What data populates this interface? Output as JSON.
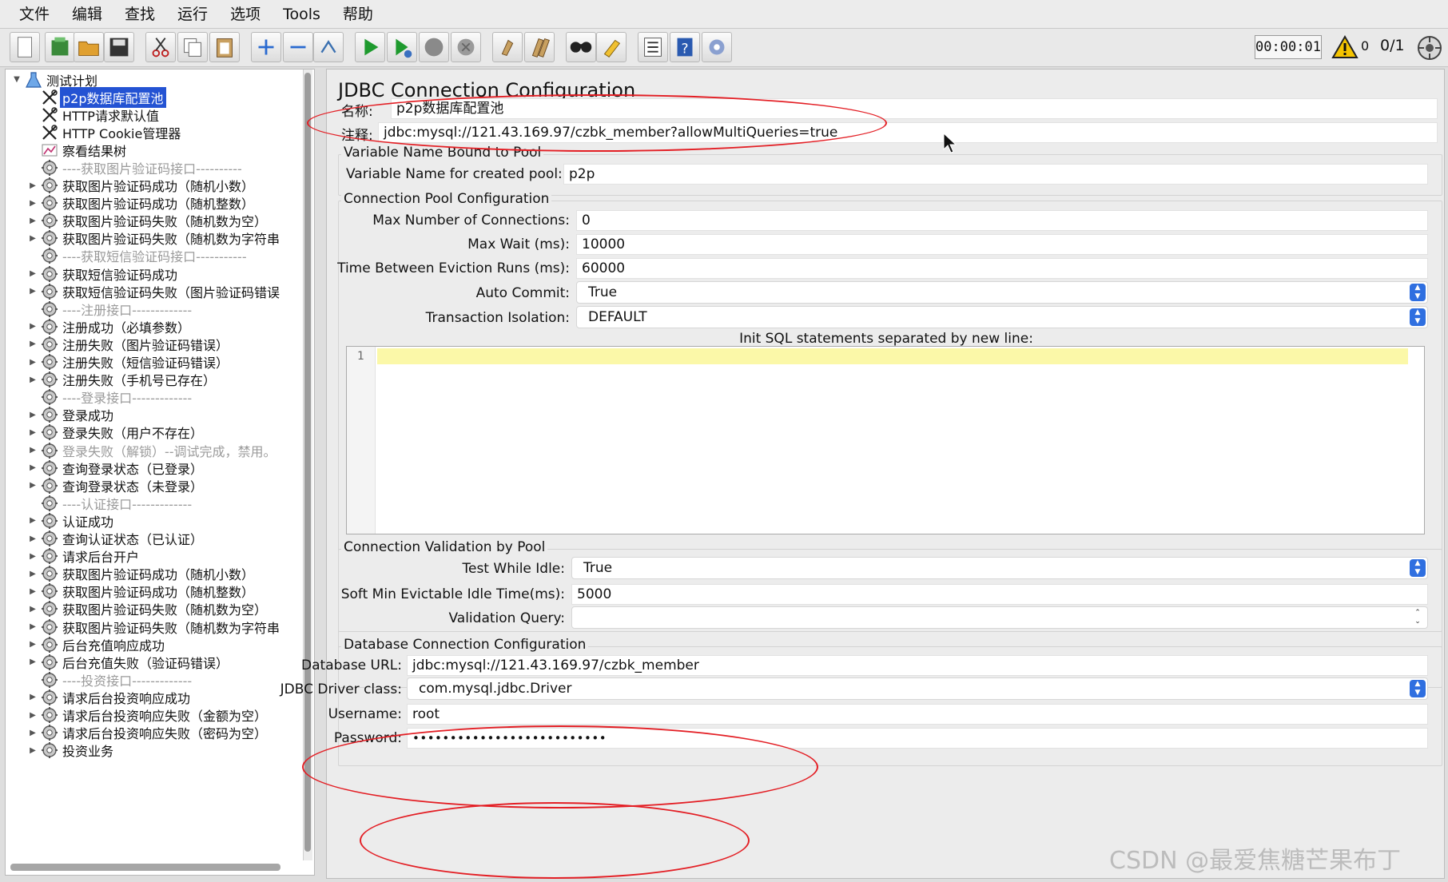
{
  "menu": [
    "文件",
    "编辑",
    "查找",
    "运行",
    "选项",
    "Tools",
    "帮助"
  ],
  "toolbar": {
    "timer": "00:00:01",
    "warning_count": "0",
    "threads": "0/1",
    "buttons": [
      "new",
      "templates",
      "open",
      "save",
      "cut",
      "copy",
      "paste",
      "expand",
      "collapse",
      "toggle",
      "start",
      "start-no-pause",
      "stop",
      "shutdown",
      "clear",
      "clear-all",
      "search",
      "reset-search",
      "function-helper",
      "help",
      "remote"
    ]
  },
  "tree": {
    "root": "测试计划",
    "items": [
      {
        "label": "p2p数据库配置池",
        "type": "config",
        "selected": true,
        "expandable": false
      },
      {
        "label": "HTTP请求默认值",
        "type": "config",
        "expandable": false
      },
      {
        "label": "HTTP Cookie管理器",
        "type": "config",
        "expandable": false
      },
      {
        "label": "察看结果树",
        "type": "listener",
        "expandable": false
      },
      {
        "label": "----获取图片验证码接口----------",
        "type": "controller",
        "disabled": true,
        "expandable": false
      },
      {
        "label": "获取图片验证码成功（随机小数）",
        "type": "controller",
        "expandable": true
      },
      {
        "label": "获取图片验证码成功（随机整数）",
        "type": "controller",
        "expandable": true
      },
      {
        "label": "获取图片验证码失败（随机数为空）",
        "type": "controller",
        "expandable": true
      },
      {
        "label": "获取图片验证码失败（随机数为字符串",
        "type": "controller",
        "expandable": true
      },
      {
        "label": "----获取短信验证码接口-----------",
        "type": "controller",
        "disabled": true,
        "expandable": false
      },
      {
        "label": "获取短信验证码成功",
        "type": "controller",
        "expandable": true
      },
      {
        "label": "获取短信验证码失败（图片验证码错误",
        "type": "controller",
        "expandable": true
      },
      {
        "label": "----注册接口-------------",
        "type": "controller",
        "disabled": true,
        "expandable": false
      },
      {
        "label": "注册成功（必填参数）",
        "type": "controller",
        "expandable": true
      },
      {
        "label": "注册失败（图片验证码错误）",
        "type": "controller",
        "expandable": true
      },
      {
        "label": "注册失败（短信验证码错误）",
        "type": "controller",
        "expandable": true
      },
      {
        "label": "注册失败（手机号已存在）",
        "type": "controller",
        "expandable": true
      },
      {
        "label": "----登录接口-------------",
        "type": "controller",
        "disabled": true,
        "expandable": false
      },
      {
        "label": "登录成功",
        "type": "controller",
        "expandable": true
      },
      {
        "label": "登录失败（用户不存在）",
        "type": "controller",
        "expandable": true
      },
      {
        "label": "登录失败（解锁）--调试完成，禁用。",
        "type": "controller",
        "disabled": true,
        "expandable": true
      },
      {
        "label": "查询登录状态（已登录）",
        "type": "controller",
        "expandable": true
      },
      {
        "label": "查询登录状态（未登录）",
        "type": "controller",
        "expandable": true
      },
      {
        "label": "----认证接口-------------",
        "type": "controller",
        "disabled": true,
        "expandable": false
      },
      {
        "label": "认证成功",
        "type": "controller",
        "expandable": true
      },
      {
        "label": "查询认证状态（已认证）",
        "type": "controller",
        "expandable": true
      },
      {
        "label": "请求后台开户",
        "type": "controller",
        "expandable": true
      },
      {
        "label": "获取图片验证码成功（随机小数）",
        "type": "controller",
        "expandable": true
      },
      {
        "label": "获取图片验证码成功（随机整数）",
        "type": "controller",
        "expandable": true
      },
      {
        "label": "获取图片验证码失败（随机数为空）",
        "type": "controller",
        "expandable": true
      },
      {
        "label": "获取图片验证码失败（随机数为字符串",
        "type": "controller",
        "expandable": true
      },
      {
        "label": "后台充值响应成功",
        "type": "controller",
        "expandable": true
      },
      {
        "label": "后台充值失败（验证码错误）",
        "type": "controller",
        "expandable": true
      },
      {
        "label": "----投资接口-------------",
        "type": "controller",
        "disabled": true,
        "expandable": false
      },
      {
        "label": "请求后台投资响应成功",
        "type": "controller",
        "expandable": true
      },
      {
        "label": "请求后台投资响应失败（金额为空）",
        "type": "controller",
        "expandable": true
      },
      {
        "label": "请求后台投资响应失败（密码为空）",
        "type": "controller",
        "expandable": true
      },
      {
        "label": "投资业务",
        "type": "controller",
        "expandable": true
      }
    ]
  },
  "panel": {
    "title": "JDBC Connection Configuration",
    "name_label": "名称:",
    "name_value": "p2p数据库配置池",
    "comment_label": "注释:",
    "comment_value": "jdbc:mysql://121.43.169.97/czbk_member?allowMultiQueries=true",
    "var_group": "Variable Name Bound to Pool",
    "var_label": "Variable Name for created pool:",
    "var_value": "p2p",
    "pool_group": "Connection Pool Configuration",
    "max_conn_label": "Max Number of Connections:",
    "max_conn_value": "0",
    "max_wait_label": "Max Wait (ms):",
    "max_wait_value": "10000",
    "eviction_label": "Time Between Eviction Runs (ms):",
    "eviction_value": "60000",
    "autocommit_label": "Auto Commit:",
    "autocommit_value": "True",
    "isolation_label": "Transaction Isolation:",
    "isolation_value": "DEFAULT",
    "init_sql_label": "Init SQL statements separated by new line:",
    "init_sql_line": "1",
    "validation_group": "Connection Validation by Pool",
    "test_idle_label": "Test While Idle:",
    "test_idle_value": "True",
    "soft_min_label": "Soft Min Evictable Idle Time(ms):",
    "soft_min_value": "5000",
    "validation_query_label": "Validation Query:",
    "validation_query_value": "",
    "db_group": "Database Connection Configuration",
    "db_url_label": "Database URL:",
    "db_url_value": "jdbc:mysql://121.43.169.97/czbk_member",
    "driver_label": "JDBC Driver class:",
    "driver_value": "com.mysql.jdbc.Driver",
    "username_label": "Username:",
    "username_value": "root",
    "password_label": "Password:",
    "password_value": "••••••••••••••••••••••••••"
  },
  "watermark": "CSDN @最爱焦糖芒果布丁",
  "colors": {
    "selection": "#2453d3",
    "annotation": "#e31e24",
    "sql_line": "#fbf8a8",
    "select_arrow": "#2f6fe0"
  }
}
